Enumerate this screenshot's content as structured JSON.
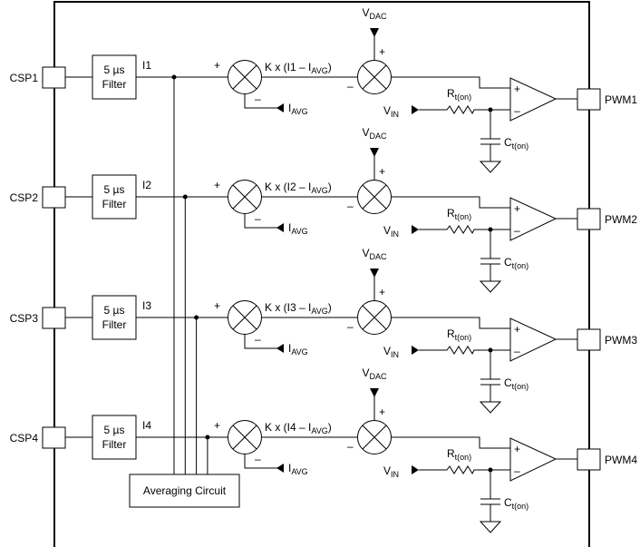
{
  "channels": [
    {
      "input_pin": "CSP1",
      "filter_line1": "5 µs",
      "filter_line2": "Filter",
      "signal": "I1",
      "expr_main": "K x (I1 – I",
      "expr_sub": "AVG",
      "expr_tail": ")",
      "output_pin": "PWM1"
    },
    {
      "input_pin": "CSP2",
      "filter_line1": "5 µs",
      "filter_line2": "Filter",
      "signal": "I2",
      "expr_main": "K x (I2 – I",
      "expr_sub": "AVG",
      "expr_tail": ")",
      "output_pin": "PWM2"
    },
    {
      "input_pin": "CSP3",
      "filter_line1": "5 µs",
      "filter_line2": "Filter",
      "signal": "I3",
      "expr_main": "K x (I3 – I",
      "expr_sub": "AVG",
      "expr_tail": ")",
      "output_pin": "PWM3"
    },
    {
      "input_pin": "CSP4",
      "filter_line1": "5 µs",
      "filter_line2": "Filter",
      "signal": "I4",
      "expr_main": "K x (I4 – I",
      "expr_sub": "AVG",
      "expr_tail": ")",
      "output_pin": "PWM4"
    }
  ],
  "labels": {
    "vdac": {
      "main": "V",
      "sub": "DAC"
    },
    "vin": {
      "main": "V",
      "sub": "IN"
    },
    "iavg": {
      "main": "I",
      "sub": "AVG"
    },
    "rton": {
      "main": "R",
      "sub": "t(on)"
    },
    "cton": {
      "main": "C",
      "sub": "t(on)"
    },
    "plus": "+",
    "minus": "–"
  },
  "averaging_circuit": "Averaging Circuit"
}
